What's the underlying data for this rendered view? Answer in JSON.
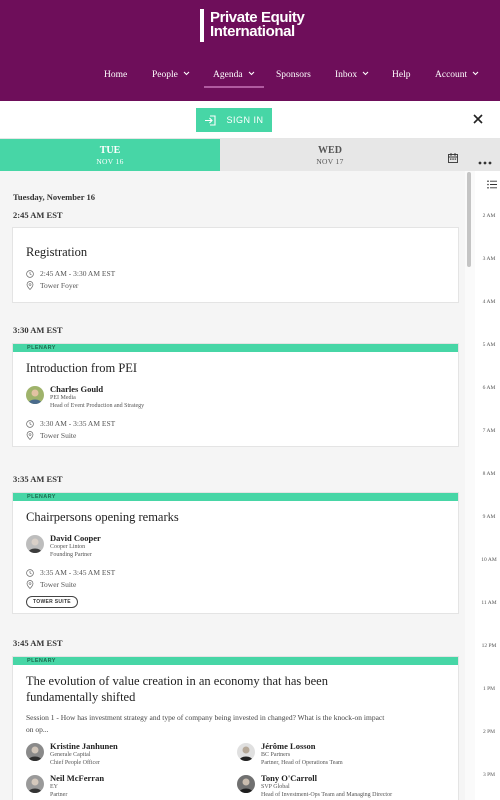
{
  "header": {
    "logo_line1": "Private Equity",
    "logo_line2": "International",
    "nav": [
      {
        "label": "Home"
      },
      {
        "label": "People"
      },
      {
        "label": "Agenda"
      },
      {
        "label": "Sponsors"
      },
      {
        "label": "Inbox"
      },
      {
        "label": "Help"
      },
      {
        "label": "Account"
      }
    ]
  },
  "signin": {
    "label": "SIGN IN"
  },
  "days": [
    {
      "dow": "TUE",
      "date": "NOV 16"
    },
    {
      "dow": "WED",
      "date": "NOV 17"
    }
  ],
  "agenda": {
    "date_heading": "Tuesday, November 16",
    "blocks": [
      {
        "time": "2:45 AM EST",
        "title": "Registration",
        "session_time": "2:45 AM - 3:30 AM EST",
        "location": "Tower Foyer"
      },
      {
        "time": "3:30 AM EST",
        "tag": "PLENARY",
        "title": "Introduction from PEI",
        "speaker": {
          "name": "Charles Gould",
          "org": "PEI Media",
          "role": "Head of Event Production and Strategy"
        },
        "session_time": "3:30 AM - 3:35 AM EST",
        "location": "Tower Suite"
      },
      {
        "time": "3:35 AM EST",
        "tag": "PLENARY",
        "title": "Chairpersons opening remarks",
        "speaker": {
          "name": "David Cooper",
          "org": "Cooper Linton",
          "role": "Founding Partner"
        },
        "session_time": "3:35 AM - 3:45 AM EST",
        "location": "Tower Suite",
        "room_tag": "TOWER SUITE"
      },
      {
        "time": "3:45 AM EST",
        "tag": "PLENARY",
        "title_line1": "The evolution of value creation in an economy that has been",
        "title_line2": "fundamentally shifted",
        "desc_line1": "Session 1 - How has investment strategy and type of company being invested in changed? What is the knock-on impact",
        "desc_line2": "on op...",
        "speakers": [
          {
            "name": "Kristine Janhunen",
            "org": "Generale Capital",
            "role": "Chief People Officer"
          },
          {
            "name": "Jérôme Losson",
            "org": "BC Partners",
            "role": "Partner, Head of Operations Team"
          },
          {
            "name": "Neil McFerran",
            "org": "EY",
            "role": "Partner"
          },
          {
            "name": "Tony O'Carroll",
            "org": "SVP Global",
            "role": "Head of Investment-Ops Team and Managing Director"
          }
        ]
      }
    ]
  },
  "rail_times": [
    "2 AM",
    "3 AM",
    "4 AM",
    "5 AM",
    "6 AM",
    "7 AM",
    "8 AM",
    "9 AM",
    "10 AM",
    "11 AM",
    "12 PM",
    "1 PM",
    "2 PM",
    "3 PM"
  ],
  "colors": {
    "header_bg": "#6e0e5a",
    "accent": "#47d6a6"
  }
}
